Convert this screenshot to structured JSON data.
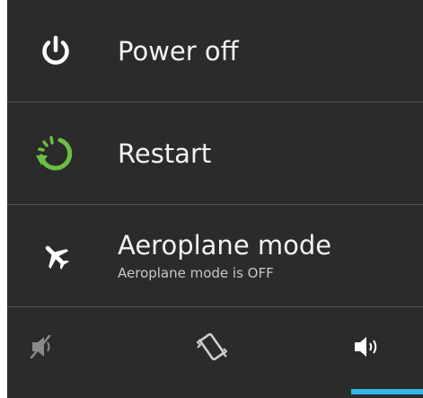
{
  "menu": {
    "power_off": {
      "label": "Power off",
      "icon": "power-icon"
    },
    "restart": {
      "label": "Restart",
      "icon": "restart-icon"
    },
    "aeroplane": {
      "label": "Aeroplane mode",
      "status": "Aeroplane mode is OFF",
      "icon": "airplane-icon"
    }
  },
  "sound_modes": {
    "options": [
      "silent",
      "vibrate",
      "sound"
    ],
    "selected": "sound"
  },
  "colors": {
    "background": "#2b2b2b",
    "text": "#f2f2f2",
    "restart_accent": "#6abf45",
    "selected_indicator": "#33b5e5"
  }
}
